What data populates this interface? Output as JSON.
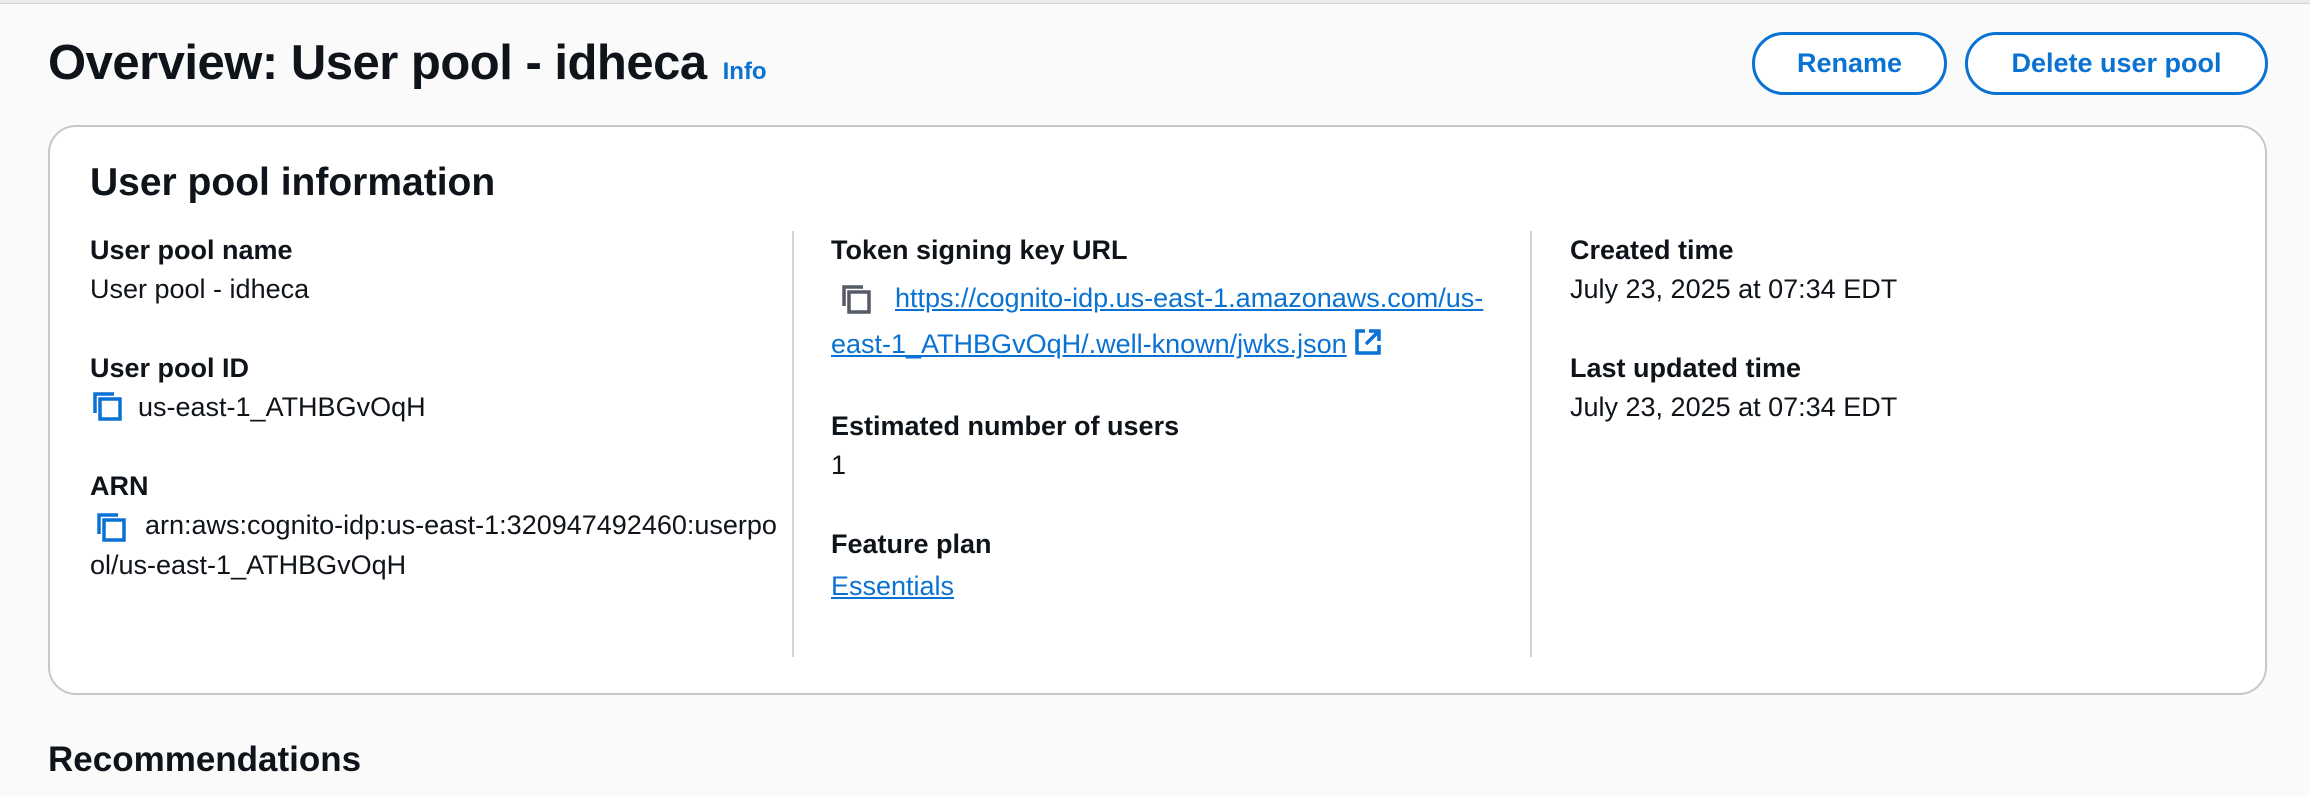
{
  "header": {
    "title": "Overview: User pool - idheca",
    "info_label": "Info",
    "rename_label": "Rename",
    "delete_label": "Delete user pool"
  },
  "panel": {
    "title": "User pool information",
    "col1": {
      "name_label": "User pool name",
      "name_value": "User pool - idheca",
      "id_label": "User pool ID",
      "id_value": "us-east-1_ATHBGvOqH",
      "arn_label": "ARN",
      "arn_value": "arn:aws:cognito-idp:us-east-1:320947492460:userpool/us-east-1_ATHBGvOqH"
    },
    "col2": {
      "token_label": "Token signing key URL",
      "token_url": "https://cognito-idp.us-east-1.amazonaws.com/us-east-1_ATHBGvOqH/.well-known/jwks.json",
      "users_label": "Estimated number of users",
      "users_value": "1",
      "plan_label": "Feature plan",
      "plan_value": "Essentials"
    },
    "col3": {
      "created_label": "Created time",
      "created_value": "July 23, 2025 at 07:34 EDT",
      "updated_label": "Last updated time",
      "updated_value": "July 23, 2025 at 07:34 EDT"
    }
  },
  "recommendations": {
    "heading": "Recommendations"
  },
  "icons": {
    "copy": "copy-icon",
    "external": "external-link-icon"
  },
  "colors": {
    "accent": "#0972d3",
    "text": "#0f141a",
    "border": "#c6c6cd",
    "background": "#fafafa"
  }
}
